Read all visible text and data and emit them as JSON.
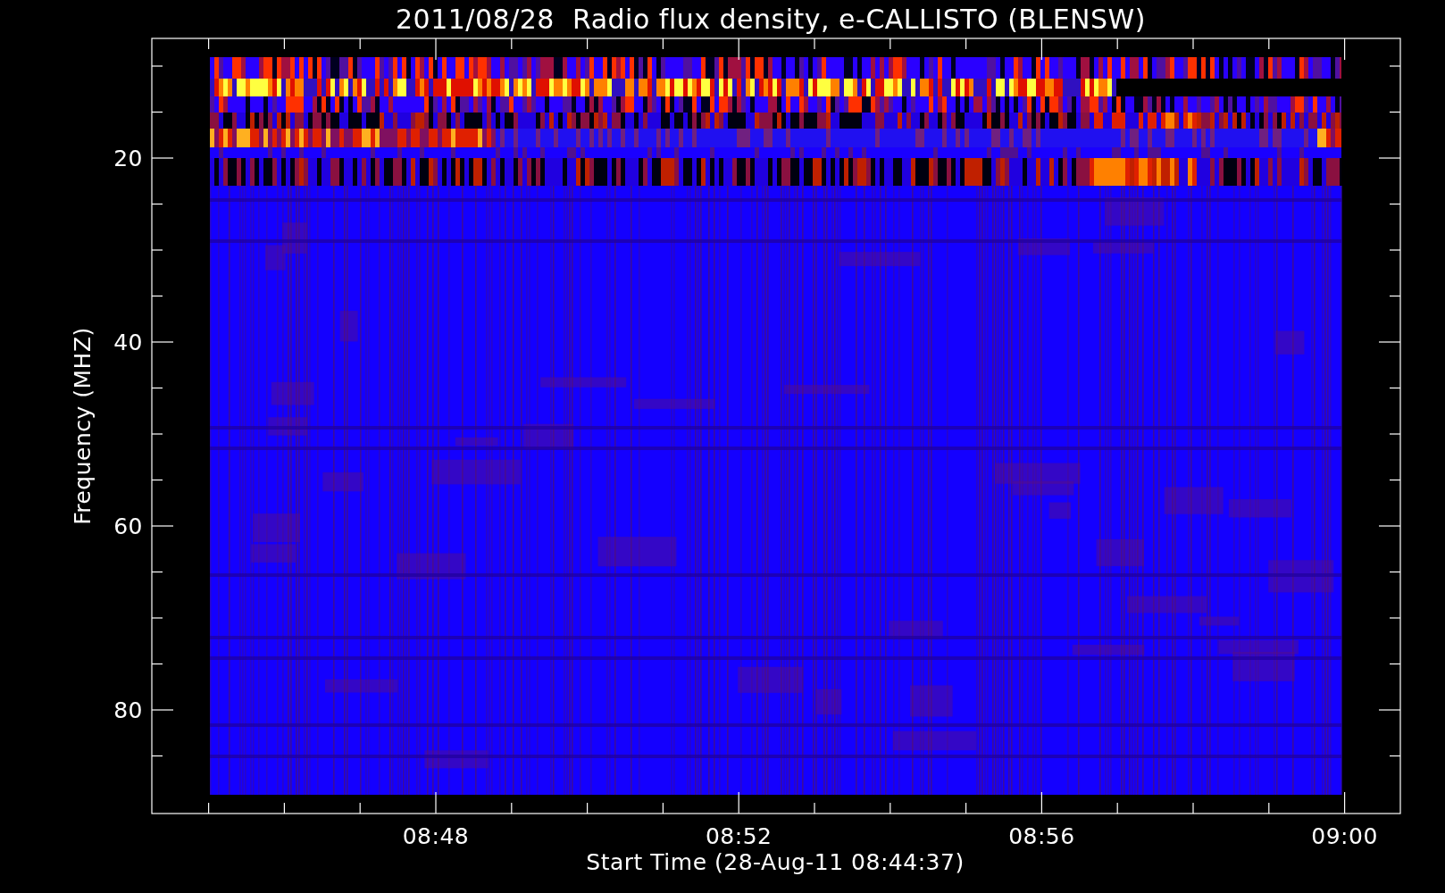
{
  "title": "2011/08/28  Radio flux density, e-CALLISTO (BLENSW)",
  "y_axis": {
    "label": "Frequency (MHZ)",
    "ticks": [
      "20",
      "40",
      "60",
      "80"
    ]
  },
  "x_axis": {
    "label": "Start Time (28-Aug-11 08:44:37)",
    "ticks": [
      "08:48",
      "08:52",
      "08:56",
      "09:00"
    ]
  }
}
